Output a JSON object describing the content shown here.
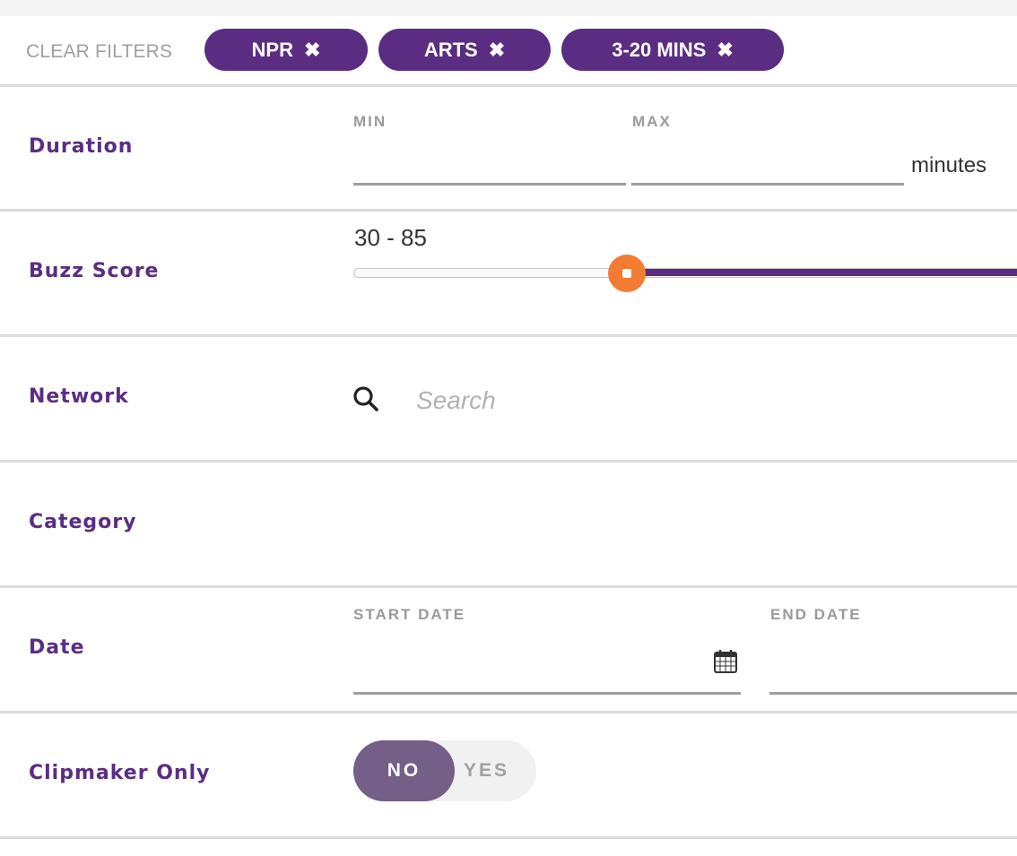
{
  "filters": {
    "clear_label": "CLEAR FILTERS",
    "chips": [
      {
        "label": "NPR",
        "remove": "✖"
      },
      {
        "label": "ARTS",
        "remove": "✖"
      },
      {
        "label": "3-20 MINS",
        "remove": "✖"
      }
    ]
  },
  "duration": {
    "label": "Duration",
    "min_label": "MIN",
    "max_label": "MAX",
    "min_value": "",
    "max_value": "",
    "unit": "minutes"
  },
  "buzz_score": {
    "label": "Buzz Score",
    "range_text": "30 - 85",
    "min": 30,
    "max": 85
  },
  "network": {
    "label": "Network",
    "search_placeholder": "Search",
    "search_icon": "search-icon"
  },
  "category": {
    "label": "Category"
  },
  "date": {
    "label": "Date",
    "start_label": "START DATE",
    "end_label": "END DATE",
    "start_value": "",
    "end_value": "",
    "calendar_icon": "calendar-icon"
  },
  "clipmaker": {
    "label": "Clipmaker Only",
    "no_label": "NO",
    "yes_label": "YES",
    "selected": "NO"
  },
  "colors": {
    "brand_purple": "#5b2d82",
    "slider_thumb": "#f27c31",
    "toggle_selected": "#735f87",
    "divider": "#dcdcdc"
  }
}
